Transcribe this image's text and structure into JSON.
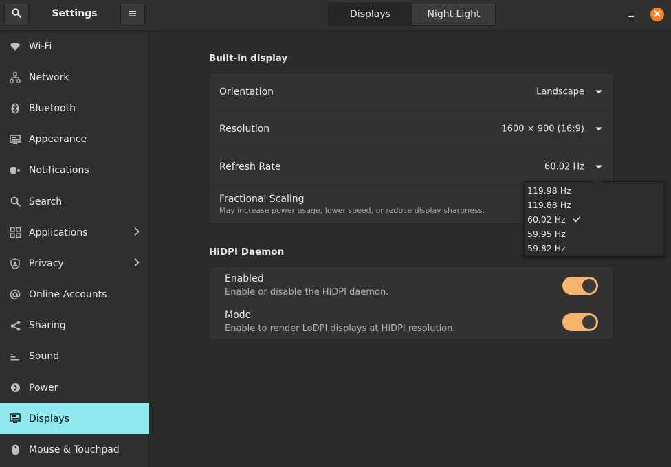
{
  "app": {
    "title": "Settings"
  },
  "sidebar": {
    "items": [
      {
        "label": "Wi-Fi",
        "icon": "wifi-icon"
      },
      {
        "label": "Network",
        "icon": "network-icon"
      },
      {
        "label": "Bluetooth",
        "icon": "bluetooth-icon"
      },
      {
        "label": "Appearance",
        "icon": "appearance-icon"
      },
      {
        "label": "Notifications",
        "icon": "notifications-icon"
      },
      {
        "label": "Search",
        "icon": "search-icon"
      },
      {
        "label": "Applications",
        "icon": "applications-icon",
        "has_submenu": true
      },
      {
        "label": "Privacy",
        "icon": "privacy-icon",
        "has_submenu": true
      },
      {
        "label": "Online Accounts",
        "icon": "online-accounts-icon"
      },
      {
        "label": "Sharing",
        "icon": "sharing-icon"
      },
      {
        "label": "Sound",
        "icon": "sound-icon"
      },
      {
        "label": "Power",
        "icon": "power-icon"
      },
      {
        "label": "Displays",
        "icon": "displays-icon",
        "active": true
      },
      {
        "label": "Mouse & Touchpad",
        "icon": "mouse-icon"
      }
    ]
  },
  "header": {
    "tabs": [
      {
        "label": "Displays",
        "active": true
      },
      {
        "label": "Night Light",
        "active": false
      }
    ]
  },
  "builtin": {
    "title": "Built-in display",
    "orientation": {
      "label": "Orientation",
      "value": "Landscape"
    },
    "resolution": {
      "label": "Resolution",
      "value": "1600 × 900 (16:9)"
    },
    "refresh": {
      "label": "Refresh Rate",
      "value": "60.02 Hz"
    },
    "scaling": {
      "label": "Fractional Scaling",
      "sub": "May increase power usage, lower speed, or reduce display sharpness."
    }
  },
  "refresh_options": [
    {
      "label": "119.98 Hz",
      "selected": false
    },
    {
      "label": "119.88 Hz",
      "selected": false
    },
    {
      "label": "60.02 Hz",
      "selected": true
    },
    {
      "label": "59.95 Hz",
      "selected": false
    },
    {
      "label": "59.82 Hz",
      "selected": false
    }
  ],
  "hidpi": {
    "title": "HiDPI Daemon",
    "enabled": {
      "label": "Enabled",
      "sub": "Enable or disable the HiDPI daemon.",
      "on": true
    },
    "mode": {
      "label": "Mode",
      "sub": "Enable to render LoDPI displays at HiDPI resolution.",
      "on": true
    }
  },
  "colors": {
    "accent": "#8fe9ef",
    "switch_on": "#f6b36b",
    "close": "#f2832b"
  }
}
